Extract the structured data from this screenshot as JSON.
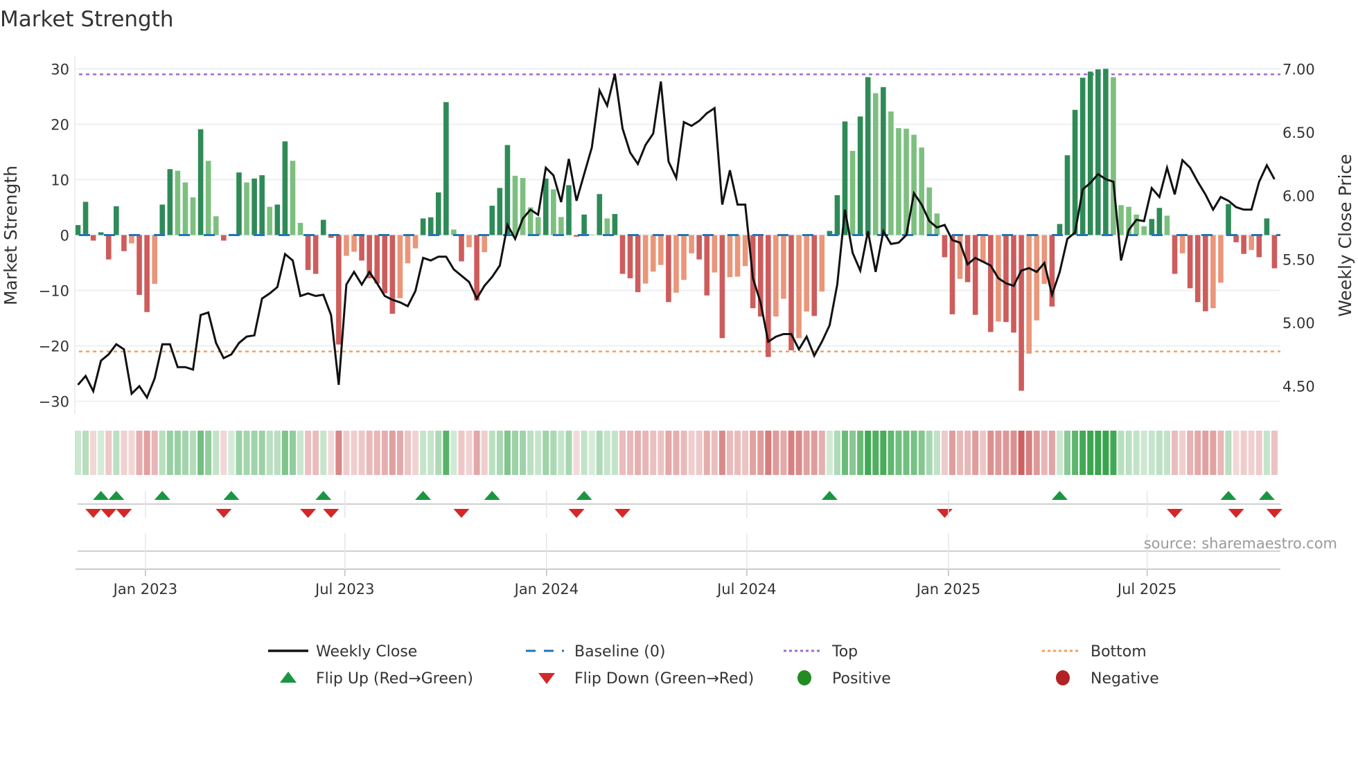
{
  "chart_data": {
    "type": "bar",
    "title": "Market Strength",
    "ylabel": "Market Strength",
    "y2label": "Weekly Close Price",
    "ylim": [
      -32.3,
      32.3
    ],
    "y2lim": [
      4.28,
      7.1
    ],
    "yticks": [
      30,
      20,
      10,
      0,
      -10,
      -20,
      -30
    ],
    "ytick_labels": [
      "30",
      "20",
      "10",
      "0",
      "−10",
      "−20",
      "−30"
    ],
    "y2ticks": [
      7.0,
      6.5,
      6.0,
      5.5,
      5.0,
      4.5
    ],
    "y2tick_labels": [
      "7.00",
      "6.50",
      "6.00",
      "5.50",
      "5.00",
      "4.50"
    ],
    "x_unit": "week index",
    "xticks": [
      {
        "label": "Jan 2023",
        "week": 8.8
      },
      {
        "label": "Jul 2023",
        "week": 34.8
      },
      {
        "label": "Jan 2024",
        "week": 61.1
      },
      {
        "label": "Jul 2024",
        "week": 87.2
      },
      {
        "label": "Jan 2025",
        "week": 113.5
      },
      {
        "label": "Jul 2025",
        "week": 139.4
      }
    ],
    "top_level": 29,
    "bottom_level": -21,
    "baseline": 0,
    "series": [
      {
        "name": "Market Strength",
        "type": "bar",
        "values": [
          1.8,
          6,
          -1,
          0.5,
          -4.4,
          5.2,
          -2.9,
          -1.5,
          -10.8,
          -13.9,
          -8.8,
          5.5,
          11.9,
          11.6,
          9.5,
          6.8,
          19.1,
          13.4,
          3.4,
          -1,
          0.2,
          11.3,
          9.5,
          10.2,
          10.8,
          5.1,
          5.5,
          16.9,
          13.4,
          2.2,
          -6.3,
          -7,
          2.75,
          -0.5,
          -19.75,
          -3.75,
          -3,
          -4.6,
          -7.8,
          -8.75,
          -10.5,
          -14.2,
          -11.4,
          -5.1,
          -2.4,
          3,
          3.2,
          7.7,
          24,
          1,
          -4.75,
          -2.2,
          -11.8,
          -3.1,
          5.3,
          8.5,
          16.25,
          10.7,
          10.3,
          5,
          3.25,
          10.2,
          8.25,
          3.25,
          9,
          -0.3,
          3.7,
          0.1,
          7.4,
          3,
          3.8,
          -7,
          -7.8,
          -10.3,
          -8.75,
          -6.6,
          -5.4,
          -12.1,
          -10.4,
          -8.1,
          -3.3,
          -4.4,
          -10.9,
          -6.75,
          -18.6,
          -7.6,
          -7.5,
          -5.6,
          -13.2,
          -14.7,
          -22,
          -14.7,
          -11.5,
          -20.8,
          -18.6,
          -13.8,
          -14.6,
          -10.2,
          0.75,
          7.2,
          20.5,
          15.2,
          21.4,
          28.5,
          25.6,
          26.7,
          22.3,
          19.3,
          19.2,
          18.1,
          15.8,
          8.6,
          3.9,
          -4,
          -14.3,
          -7.9,
          -8.5,
          -14.4,
          -4.9,
          -17.5,
          -15.6,
          -15.7,
          -17.6,
          -28.1,
          -21.4,
          -15.4,
          -8.8,
          -12.9,
          2,
          14.4,
          22.6,
          28.4,
          29.5,
          29.9,
          30,
          28.5,
          5.4,
          5.1,
          3.7,
          1.6,
          2.9,
          4.9,
          3.5,
          -7,
          -3.3,
          -9.6,
          -12.1,
          -13.75,
          -13.2,
          -8.6,
          5.6,
          -1.3,
          -3.4,
          -2.7,
          -4,
          3,
          -6
        ]
      },
      {
        "name": "Weekly Close",
        "type": "line",
        "axis": "right",
        "values": [
          4.51,
          4.58,
          4.46,
          4.7,
          4.75,
          4.83,
          4.79,
          4.44,
          4.5,
          4.41,
          4.56,
          4.83,
          4.83,
          4.65,
          4.65,
          4.63,
          5.06,
          5.08,
          4.84,
          4.72,
          4.75,
          4.84,
          4.89,
          4.9,
          5.19,
          5.23,
          5.28,
          5.54,
          5.49,
          5.21,
          5.23,
          5.21,
          5.22,
          5.06,
          4.51,
          5.3,
          5.4,
          5.3,
          5.4,
          5.31,
          5.21,
          5.18,
          5.16,
          5.13,
          5.25,
          5.51,
          5.49,
          5.52,
          5.52,
          5.42,
          5.37,
          5.32,
          5.19,
          5.29,
          5.36,
          5.45,
          5.77,
          5.66,
          5.82,
          5.89,
          5.85,
          6.22,
          6.16,
          5.95,
          6.29,
          5.96,
          6.17,
          6.38,
          6.83,
          6.71,
          6.96,
          6.53,
          6.34,
          6.25,
          6.4,
          6.49,
          6.9,
          6.27,
          6.14,
          6.58,
          6.55,
          6.59,
          6.65,
          6.69,
          5.93,
          6.2,
          5.93,
          5.93,
          5.35,
          5.16,
          4.85,
          4.89,
          4.91,
          4.91,
          4.79,
          4.89,
          4.74,
          4.85,
          4.98,
          5.3,
          5.89,
          5.55,
          5.41,
          5.72,
          5.4,
          5.72,
          5.62,
          5.63,
          5.69,
          6.02,
          5.93,
          5.8,
          5.75,
          5.77,
          5.65,
          5.63,
          5.46,
          5.51,
          5.48,
          5.45,
          5.35,
          5.31,
          5.29,
          5.41,
          5.43,
          5.4,
          5.47,
          5.22,
          5.4,
          5.66,
          5.71,
          6.05,
          6.1,
          6.17,
          6.13,
          6.11,
          5.49,
          5.73,
          5.81,
          5.8,
          6.06,
          5.99,
          6.22,
          6.01,
          6.28,
          6.22,
          6.11,
          6.01,
          5.89,
          5.99,
          5.96,
          5.91,
          5.89,
          5.89,
          6.11,
          6.24,
          6.13
        ]
      }
    ],
    "legend": {
      "placement": "bottom-center",
      "items": [
        {
          "label": "Weekly Close",
          "symbol": "line"
        },
        {
          "label": "Baseline (0)",
          "symbol": "dashed-line"
        },
        {
          "label": "Top",
          "symbol": "dotted-line"
        },
        {
          "label": "Bottom",
          "symbol": "dotted-line"
        },
        {
          "label": "Flip Up (Red→Green)",
          "symbol": "triangle-up"
        },
        {
          "label": "Flip Down (Green→Red)",
          "symbol": "triangle-down"
        },
        {
          "label": "Positive",
          "symbol": "circle"
        },
        {
          "label": "Negative",
          "symbol": "circle"
        }
      ]
    },
    "annotation": "source: sharemaestro.com"
  },
  "colors": {
    "bar_pos_rising": "#2e8b57",
    "bar_pos_falling": "#7dbf7f",
    "bar_neg_falling": "#cd5c5c",
    "bar_neg_rising": "#e9967a",
    "line": "#111111",
    "baseline": "#1f77b4",
    "top": "#9b6bd6",
    "bottom": "#f0a060",
    "flip_up": "#1a9641",
    "flip_down": "#d62728",
    "positive": "#228b22",
    "negative": "#b22222",
    "heat_pos": "46,160,67",
    "heat_neg": "200,80,80",
    "grid": "#eceff3"
  }
}
